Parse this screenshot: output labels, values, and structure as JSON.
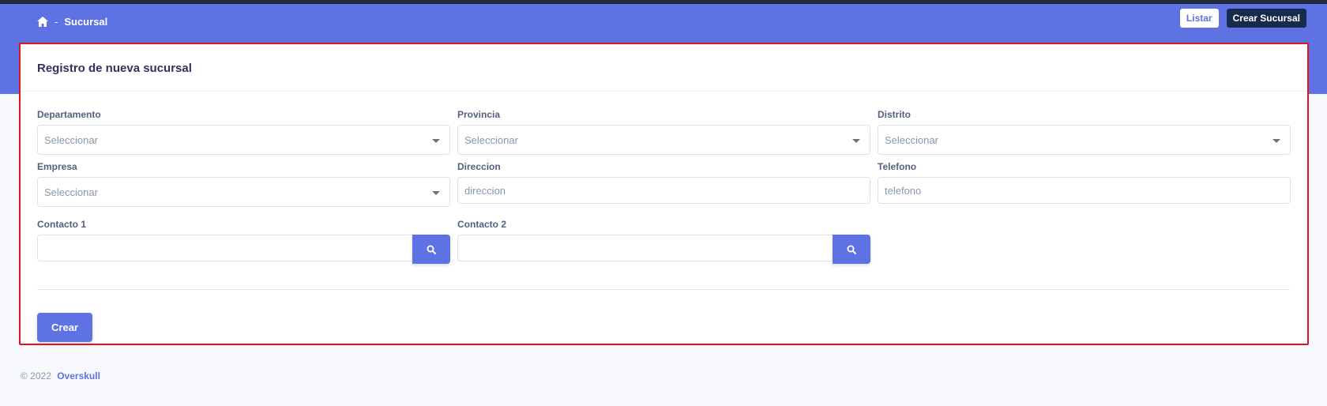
{
  "breadcrumb": {
    "home_icon": "home-icon",
    "separator": "-",
    "current": "Sucursal"
  },
  "header_buttons": {
    "listar": "Listar",
    "crear_sucursal": "Crear Sucursal"
  },
  "form": {
    "title": "Registro de nueva sucursal",
    "departamento": {
      "label": "Departamento",
      "value": "Seleccionar"
    },
    "provincia": {
      "label": "Provincia",
      "value": "Seleccionar"
    },
    "distrito": {
      "label": "Distrito",
      "value": "Seleccionar"
    },
    "empresa": {
      "label": "Empresa",
      "value": "Seleccionar"
    },
    "direccion": {
      "label": "Direccion",
      "placeholder": "direccion"
    },
    "telefono": {
      "label": "Telefono",
      "placeholder": "telefono"
    },
    "contacto1": {
      "label": "Contacto 1",
      "value": ""
    },
    "contacto2": {
      "label": "Contacto 2",
      "value": ""
    },
    "submit_label": "Crear"
  },
  "footer": {
    "copyright": "© 2022",
    "brand": "Overskull"
  },
  "colors": {
    "primary": "#5e72e4",
    "dark": "#172b4d",
    "highlight_border": "#e5141c"
  }
}
